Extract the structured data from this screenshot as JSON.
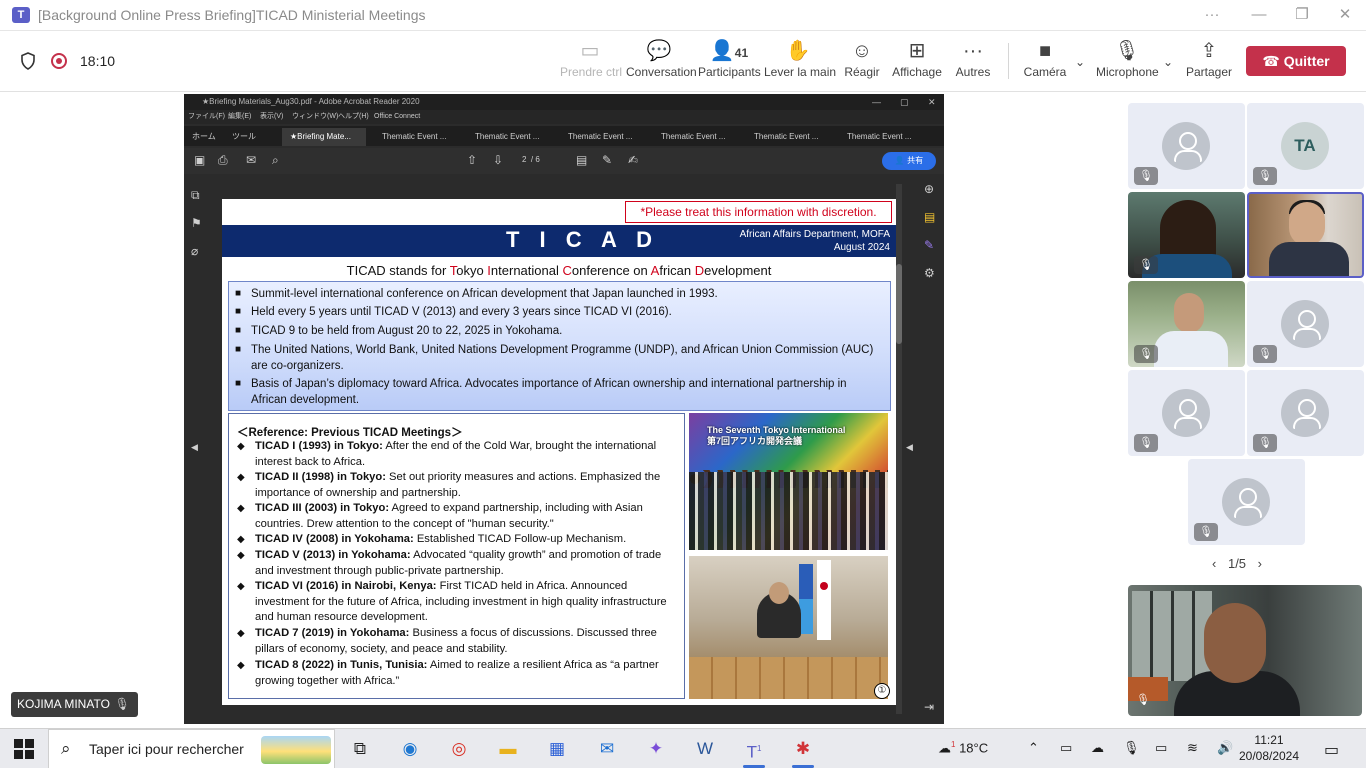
{
  "window": {
    "title": "[Background Online Press Briefing]TICAD Ministerial Meetings",
    "controls": [
      "···",
      "—",
      "❐",
      "✕"
    ]
  },
  "meeting": {
    "timer": "18:10",
    "toolbar": [
      {
        "label": "Prendre ctrl",
        "icon": "share-screen-icon",
        "disabled": true
      },
      {
        "label": "Conversation",
        "icon": "chat-icon"
      },
      {
        "label": "Participants",
        "icon": "people-icon",
        "count": "41"
      },
      {
        "label": "Lever la main",
        "icon": "raise-hand-icon"
      },
      {
        "label": "Réagir",
        "icon": "smile-icon"
      },
      {
        "label": "Affichage",
        "icon": "grid-icon"
      },
      {
        "label": "Autres",
        "icon": "more-icon"
      },
      {
        "label": "Caméra",
        "icon": "camera-icon"
      },
      {
        "label": "Microphone",
        "icon": "mic-off-icon"
      },
      {
        "label": "Partager",
        "icon": "share-icon"
      }
    ],
    "quit_label": "Quitter",
    "presenter_name": "KOJIMA MINATO"
  },
  "acrobat": {
    "title": "★Briefing Materials_Aug30.pdf - Adobe Acrobat Reader 2020",
    "menu": [
      "ファイル(F)",
      "編集(E)",
      "表示(V)",
      "ウィンドウ(W)",
      "ヘルプ(H)",
      "Office Connect"
    ],
    "nav": [
      "ホーム",
      "ツール"
    ],
    "tabs": [
      "★Briefing Mate...",
      "Thematic Event ...",
      "Thematic Event ...",
      "Thematic Event ...",
      "Thematic Event ...",
      "Thematic Event ...",
      "Thematic Event ..."
    ],
    "page_current": "2",
    "page_total": "/ 6",
    "share_label": "共有"
  },
  "slide": {
    "discretion": "*Please treat this information with discretion.",
    "banner_title": "T I C A D",
    "dept": "African Affairs Department, MOFA",
    "date": "August 2024",
    "stands": {
      "prefix": "TICAD stands for ",
      "t": "T",
      "okyo": "okyo ",
      "i": "I",
      "nternational": "nternational ",
      "c": "C",
      "onference": "onference on ",
      "a": "A",
      "frican": "frican ",
      "d": "D",
      "evelopment": "evelopment"
    },
    "bullets": [
      "Summit-level international conference on African development that Japan launched in 1993.",
      "Held every 5 years until TICAD V (2013) and every 3 years since TICAD VI (2016).",
      "TICAD 9 to be held from August 20 to 22, 2025 in Yokohama.",
      "The United Nations, World Bank, United Nations Development Programme (UNDP), and African Union Commission (AUC) are co-organizers.",
      "Basis of Japan’s diplomacy toward Africa. Advocates importance of African ownership and international partnership in African development."
    ],
    "reference_title": "＜Reference: Previous TICAD Meetings＞",
    "meetings": [
      {
        "name": "TICAD I (1993) in Tokyo:",
        "text": " After the end of the Cold War, brought the international interest back to Africa."
      },
      {
        "name": "TICAD II (1998) in Tokyo:",
        "text": " Set out priority measures and actions. Emphasized the importance of ownership and partnership."
      },
      {
        "name": "TICAD III (2003) in Tokyo:",
        "text": " Agreed to expand partnership, including with Asian countries. Drew attention to the concept of \"human security.\""
      },
      {
        "name": "TICAD IV (2008) in Yokohama:",
        "text": " Established TICAD Follow-up Mechanism."
      },
      {
        "name": "TICAD V (2013) in Yokohama:",
        "text": " Advocated “quality growth” and promotion of trade and investment through public-private partnership."
      },
      {
        "name": "TICAD VI (2016) in Nairobi, Kenya:",
        "text": " First TICAD held in Africa. Announced investment for the future of Africa, including investment in high quality infrastructure and human resource development."
      },
      {
        "name": "TICAD 7 (2019) in Yokohama:",
        "text": " Business a focus of discussions. Discussed three pillars of economy, society, and peace and stability."
      },
      {
        "name": "TICAD 8 (2022) in Tunis, Tunisia:",
        "text": " Aimed to realize a resilient Africa as “a partner growing together with Africa.”"
      }
    ],
    "photo_caption": "The Seventh Tokyo International\n第7回アフリカ開発会議",
    "page_number": "①"
  },
  "participants": {
    "tiles": [
      {
        "type": "avatar"
      },
      {
        "type": "initials",
        "initials": "TA"
      },
      {
        "type": "video"
      },
      {
        "type": "video"
      },
      {
        "type": "video"
      },
      {
        "type": "avatar"
      },
      {
        "type": "avatar"
      },
      {
        "type": "avatar"
      },
      {
        "type": "avatar"
      }
    ],
    "pager": "1/5"
  },
  "taskbar": {
    "search_placeholder": "Taper ici pour rechercher",
    "weather": "18°C",
    "weather_badge": "1",
    "teams_badge": "1",
    "time": "11:21",
    "date": "20/08/2024"
  },
  "colors": {
    "quit": "#c4314b",
    "banner": "#0d2a6e",
    "accent": "#5b5fc7",
    "red_text": "#d0021b"
  }
}
